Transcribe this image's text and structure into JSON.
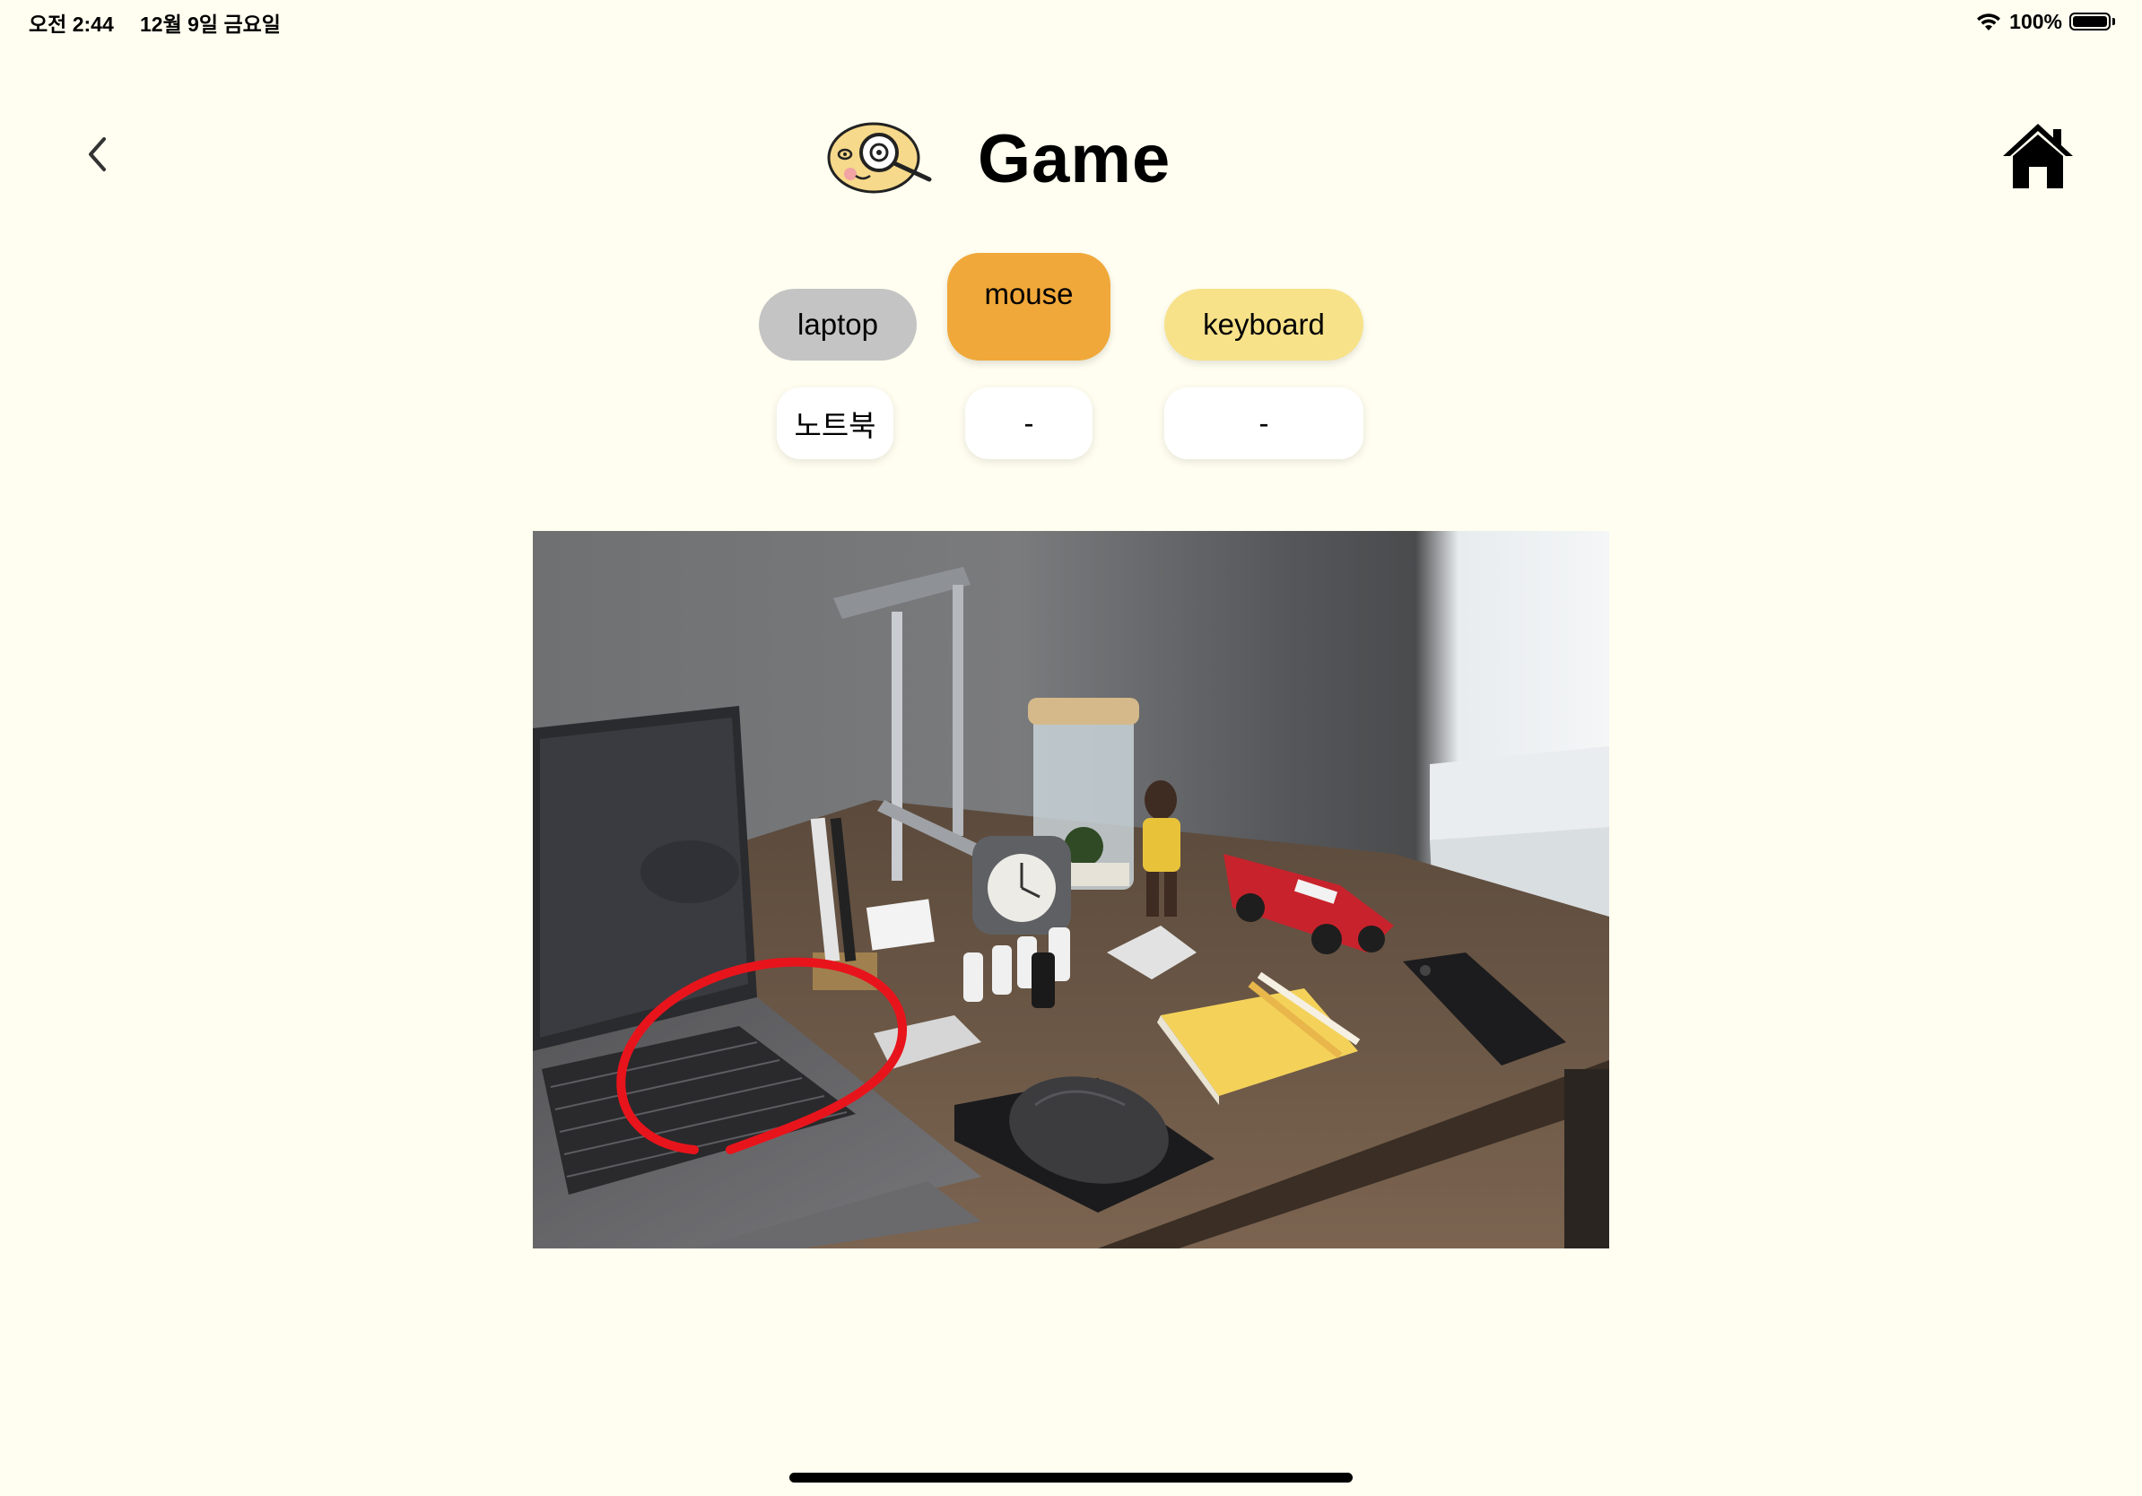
{
  "status": {
    "time": "오전 2:44",
    "date": "12월 9일 금요일",
    "battery_text": "100%",
    "battery_level": 1.0
  },
  "header": {
    "title": "Game",
    "back_icon": "chevron-left-icon",
    "home_icon": "home-icon",
    "logo_icon": "potato-magnifier-logo"
  },
  "words": [
    {
      "label": "laptop",
      "answer": "노트북",
      "state": "answered",
      "color": "#C4C4C4"
    },
    {
      "label": "mouse",
      "answer": "-",
      "state": "selected",
      "color": "#F0A83A"
    },
    {
      "label": "keyboard",
      "answer": "-",
      "state": "unanswered",
      "color": "#F7E28A"
    }
  ],
  "colors": {
    "background": "#FFFEF0",
    "circle_mark": "#E8141C"
  }
}
